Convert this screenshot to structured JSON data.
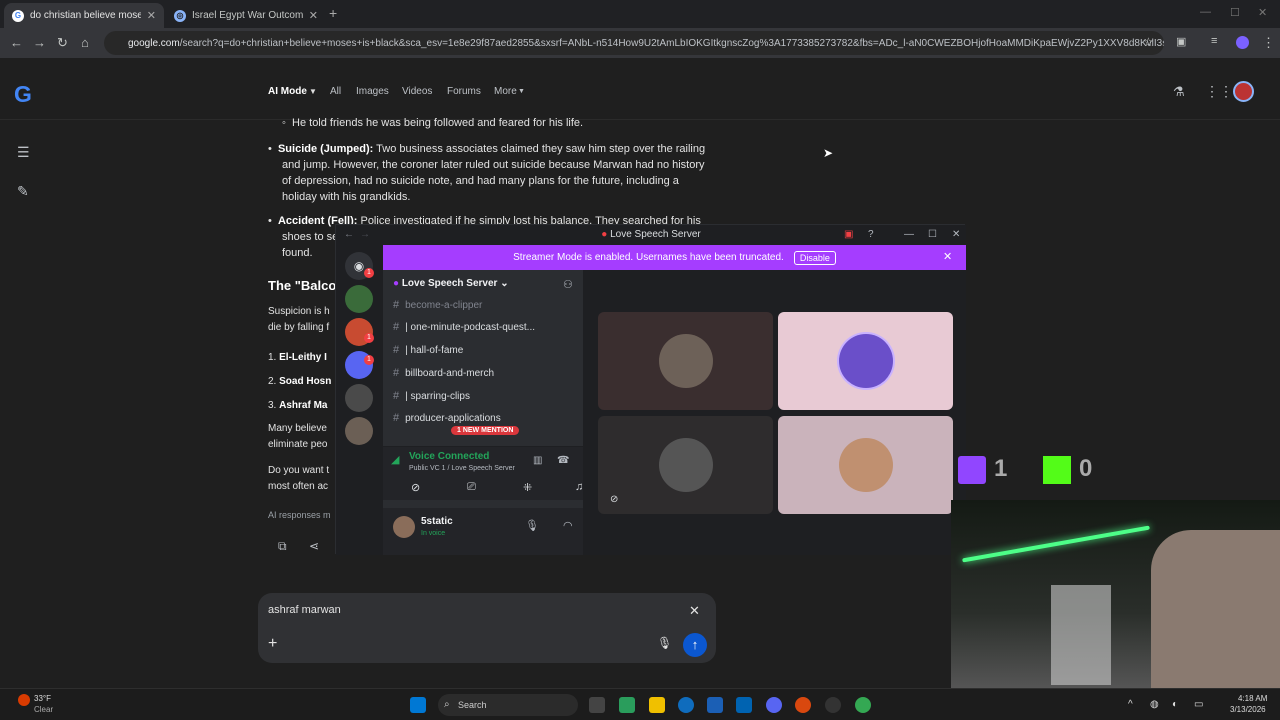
{
  "browser": {
    "tabs": [
      {
        "title": "do christian believe moses is bl",
        "active": true
      },
      {
        "title": "Israel Egypt War Outcome",
        "active": false
      }
    ],
    "url_host": "google.com",
    "url_rest": "/search?q=do+christian+believe+moses+is+black&sca_esv=1e8e29f87aed2855&sxsrf=ANbL-n514How9U2tAmLbIOKGItkgnscZog%3A1773385273782&fbs=ADc_l-aN0CWEZBOHjofHoaMMDiKpaEWjvZ2Py1XXV8d8KvlI3sbM0Xv-8Z..."
  },
  "google": {
    "nav": [
      "AI Mode",
      "All",
      "Images",
      "Videos",
      "Forums",
      "More"
    ],
    "content": {
      "sub_bullet": "He told friends he was being followed and feared for his life.",
      "bullet1_bold": "Suicide (Jumped):",
      "bullet1_l1": " Two business associates claimed they saw him step over the railing",
      "bullet1_l2": "and jump. However, the coroner later ruled out suicide because Marwan had no history",
      "bullet1_l3": "of depression, had no suicide note, and had many plans for the future, including a",
      "bullet1_l4": "holiday with his grandkids.",
      "bullet2_bold": "Accident (Fell):",
      "bullet2_l1": " Police investigated if he simply lost his balance. They searched for his",
      "bullet2_l2": "shoes to se",
      "bullet2_l3": "found.",
      "section_heading": "The \"Balco",
      "para1_l1": "Suspicion is h",
      "para1_l2": "die by falling f",
      "list1": "El-Leithy I",
      "list2": "Soad Hosn",
      "list3": "Ashraf Ma",
      "para2_l1": "Many believe",
      "para2_l2": "eliminate peo",
      "para3_l1": "Do you want t",
      "para3_l2": "most often ac",
      "disclaimer": "AI responses m"
    },
    "prompt_text": "ashraf marwan"
  },
  "discord": {
    "title": "Love Speech Server",
    "streamer_notice": "Streamer Mode is enabled. Usernames have been truncated.",
    "disable_label": "Disable",
    "server_name": "Love Speech Server",
    "channels": [
      "become-a-clipper",
      "| one-minute-podcast-quest...",
      "| hall-of-fame",
      "billboard-and-merch",
      "| sparring-clips",
      "producer-applications"
    ],
    "new_mention": "1 NEW MENTION",
    "voice_status": "Voice Connected",
    "voice_channel": "Public VC 1 / Love Speech Server",
    "username": "5static",
    "user_status": "In voice",
    "server_badges": [
      "1",
      "1",
      "1"
    ]
  },
  "stream_overlay": {
    "twitch_count": "1",
    "kick_count": "0"
  },
  "taskbar": {
    "weather_temp": "33°F",
    "weather_desc": "Clear",
    "search_label": "Search",
    "time": "4:18 AM",
    "date": "3/13/2026"
  }
}
